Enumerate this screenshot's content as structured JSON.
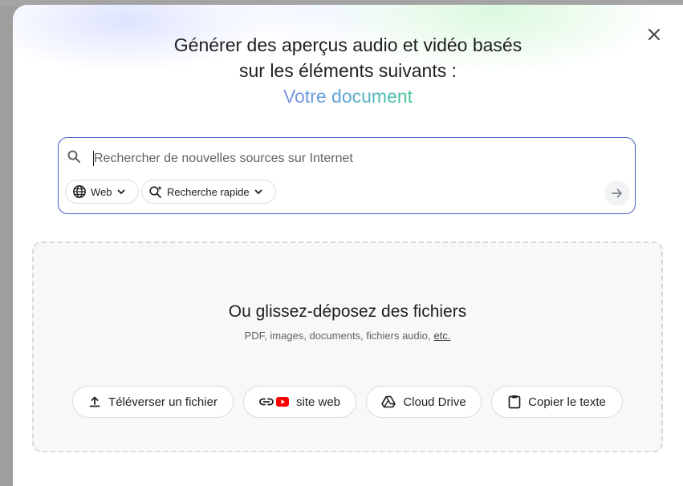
{
  "dialog": {
    "title_line1": "Générer des aperçus audio et vidéo basés",
    "title_line2": "sur les éléments suivants :",
    "title_accent": "Votre document",
    "accent_colors": [
      "#7b8fe0",
      "#5aa6d8",
      "#45c59a"
    ],
    "close_icon": "close-icon"
  },
  "search": {
    "placeholder": "Rechercher de nouvelles sources sur Internet",
    "value": "",
    "border_color": "#4a5fc1",
    "chips": {
      "web_label": "Web",
      "web_icon": "globe-icon",
      "mode_label": "Recherche rapide",
      "mode_icon": "sparkle-search-icon"
    },
    "submit_icon": "arrow-right-icon"
  },
  "dropzone": {
    "title": "Ou glissez-déposez des fichiers",
    "subtitle": "PDF, images, documents, fichiers audio,",
    "etc_link": "etc.",
    "buttons": {
      "upload_label": "Téléverser un fichier",
      "upload_icon": "upload-icon",
      "website_label": "site web",
      "website_icons": [
        "link-icon",
        "youtube-icon"
      ],
      "drive_label": "Cloud Drive",
      "drive_icon": "drive-icon",
      "paste_label": "Copier le texte",
      "paste_icon": "clipboard-icon"
    }
  }
}
